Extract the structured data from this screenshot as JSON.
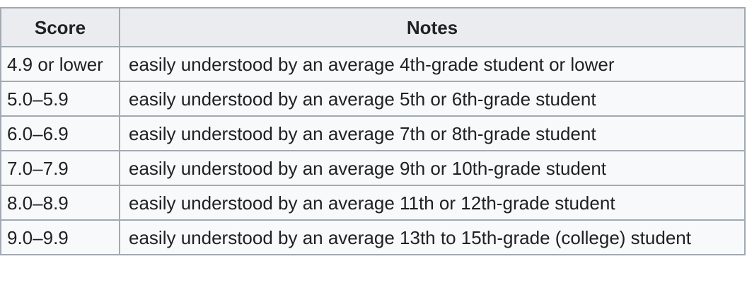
{
  "table": {
    "headers": {
      "score": "Score",
      "notes": "Notes"
    },
    "rows": [
      {
        "score": "4.9 or lower",
        "notes": "easily understood by an average 4th-grade student or lower"
      },
      {
        "score": "5.0–5.9",
        "notes": "easily understood by an average 5th or 6th-grade student"
      },
      {
        "score": "6.0–6.9",
        "notes": "easily understood by an average 7th or 8th-grade student"
      },
      {
        "score": "7.0–7.9",
        "notes": "easily understood by an average 9th or 10th-grade student"
      },
      {
        "score": "8.0–8.9",
        "notes": "easily understood by an average 11th or 12th-grade student"
      },
      {
        "score": "9.0–9.9",
        "notes": "easily understood by an average 13th to 15th-grade (college) student"
      }
    ]
  }
}
